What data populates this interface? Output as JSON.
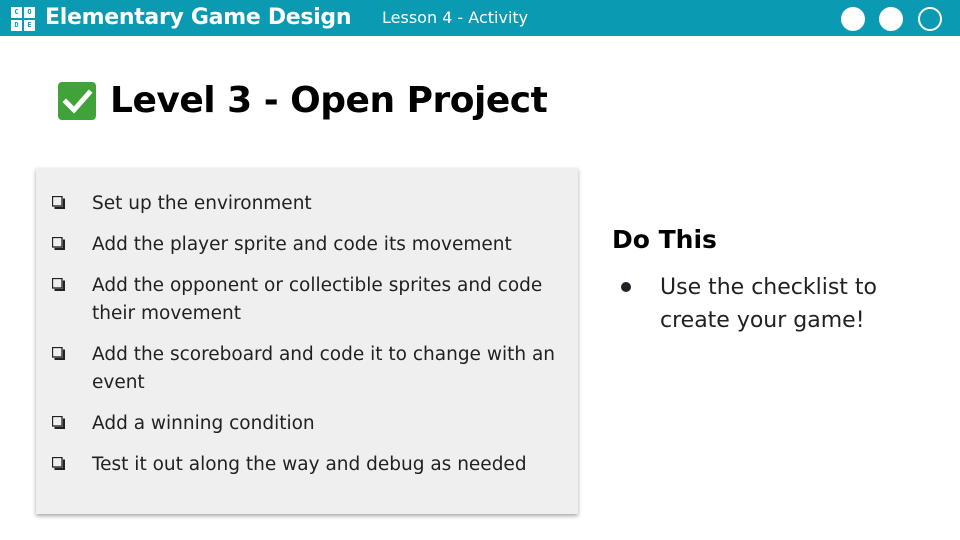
{
  "header": {
    "logo_letters": [
      "C",
      "O",
      "D",
      "E"
    ],
    "course_title": "Elementary Game Design",
    "lesson": "Lesson 4 - Activity",
    "background": "#0a9bb3"
  },
  "slide": {
    "title_icon": "check-box-icon",
    "title_icon_color": "#3fa33a",
    "title": "Level 3 - Open Project"
  },
  "checklist": {
    "items": [
      {
        "text": "Set up the environment"
      },
      {
        "text": "Add the player sprite and code its movement"
      },
      {
        "text": "Add the opponent or collectible sprites and code their movement"
      },
      {
        "text": "Add the scoreboard and code it to change with an event"
      },
      {
        "text": "Add a winning condition"
      },
      {
        "text": "Test it out along the way and debug as needed"
      }
    ]
  },
  "do_this": {
    "heading": "Do This",
    "bullets": [
      "Use the checklist to create your game!"
    ]
  }
}
